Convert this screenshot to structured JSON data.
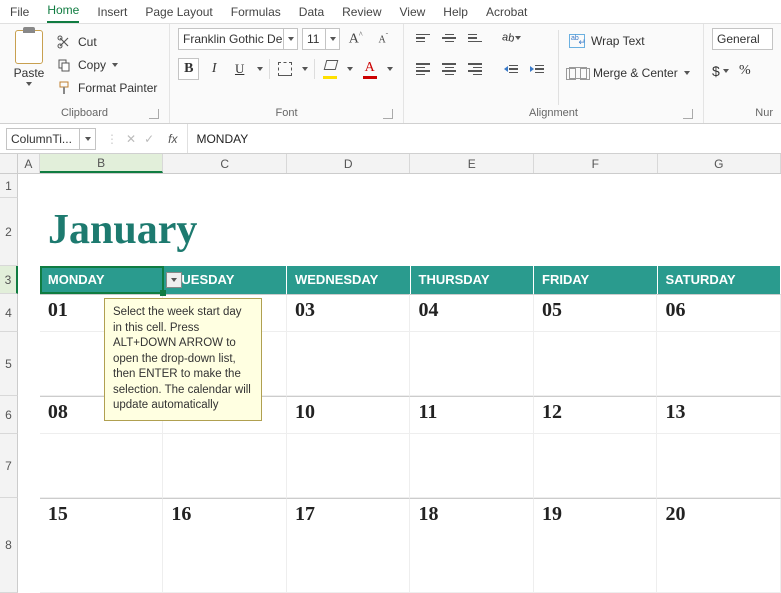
{
  "menu": {
    "tabs": [
      "File",
      "Home",
      "Insert",
      "Page Layout",
      "Formulas",
      "Data",
      "Review",
      "View",
      "Help",
      "Acrobat"
    ],
    "active": "Home"
  },
  "ribbon": {
    "clipboard": {
      "paste": "Paste",
      "cut": "Cut",
      "copy": "Copy",
      "format_painter": "Format Painter",
      "label": "Clipboard"
    },
    "font": {
      "name": "Franklin Gothic Dem",
      "size": "11",
      "label": "Font"
    },
    "alignment": {
      "wrap": "Wrap Text",
      "merge": "Merge & Center",
      "label": "Alignment"
    },
    "number": {
      "format": "General",
      "label": "Nur"
    }
  },
  "formula_bar": {
    "name_box": "ColumnTi...",
    "fx": "fx",
    "formula": "MONDAY"
  },
  "grid": {
    "cols": [
      "A",
      "B",
      "C",
      "D",
      "E",
      "F",
      "G"
    ],
    "active_col": "B",
    "rows": [
      "1",
      "2",
      "3",
      "4",
      "5",
      "6",
      "7",
      "8"
    ],
    "active_row": "3"
  },
  "calendar": {
    "month": "January",
    "headers": [
      "MONDAY",
      "UESDAY",
      "WEDNESDAY",
      "THURSDAY",
      "FRIDAY",
      "SATURDAY"
    ],
    "week1": [
      "01",
      "",
      "03",
      "04",
      "05",
      "06"
    ],
    "week2": [
      "08",
      "",
      "10",
      "11",
      "12",
      "13"
    ],
    "week3": [
      "15",
      "16",
      "17",
      "18",
      "19",
      "20"
    ]
  },
  "tooltip": "Select the week start day in this cell. Press ALT+DOWN ARROW to open the drop-down list, then ENTER to make the selection. The calendar will update automatically"
}
